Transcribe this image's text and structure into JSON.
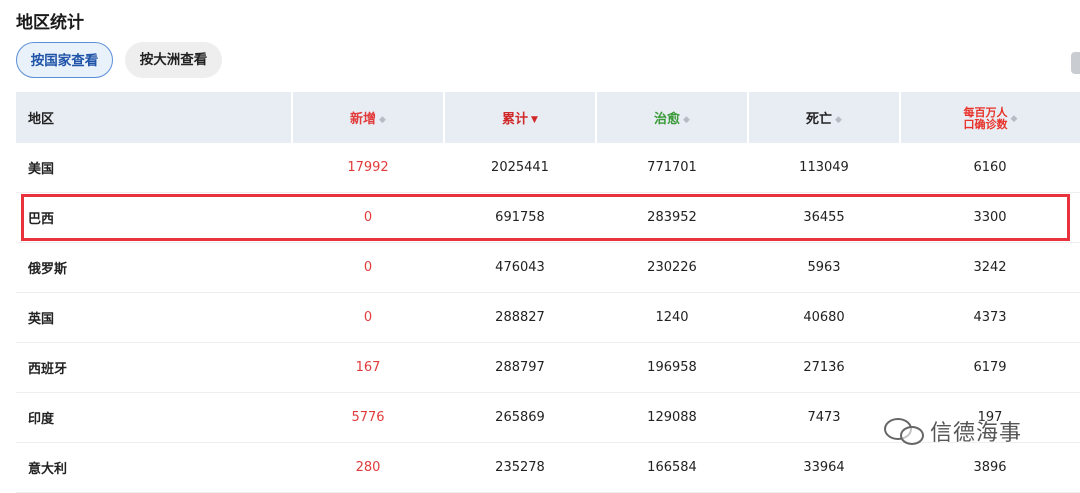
{
  "page_title": "地区统计",
  "tabs": [
    {
      "label": "按国家查看",
      "active": true
    },
    {
      "label": "按大洲查看",
      "active": false
    }
  ],
  "table": {
    "headers": {
      "region": "地区",
      "new": "新增",
      "total": "累计",
      "recovered": "治愈",
      "deaths": "死亡",
      "rate": "每百万人口确诊数"
    },
    "header_colors": {
      "new": "#e23b3b",
      "total": "#d02828",
      "recovered": "#3a9a3a",
      "deaths": "#222222",
      "rate": "#e8322a"
    },
    "sorted_by": "total",
    "rows": [
      {
        "region": "美国",
        "new": "17992",
        "total": "2025441",
        "recovered": "771701",
        "deaths": "113049",
        "rate": "6160"
      },
      {
        "region": "巴西",
        "new": "0",
        "total": "691758",
        "recovered": "283952",
        "deaths": "36455",
        "rate": "3300"
      },
      {
        "region": "俄罗斯",
        "new": "0",
        "total": "476043",
        "recovered": "230226",
        "deaths": "5963",
        "rate": "3242"
      },
      {
        "region": "英国",
        "new": "0",
        "total": "288827",
        "recovered": "1240",
        "deaths": "40680",
        "rate": "4373"
      },
      {
        "region": "西班牙",
        "new": "167",
        "total": "288797",
        "recovered": "196958",
        "deaths": "27136",
        "rate": "6179"
      },
      {
        "region": "印度",
        "new": "5776",
        "total": "265869",
        "recovered": "129088",
        "deaths": "7473",
        "rate": "197"
      },
      {
        "region": "意大利",
        "new": "280",
        "total": "235278",
        "recovered": "166584",
        "deaths": "33964",
        "rate": "3896"
      }
    ]
  },
  "highlighted_region": "巴西",
  "highlight_color": "#e8323c",
  "watermark": "信德海事"
}
